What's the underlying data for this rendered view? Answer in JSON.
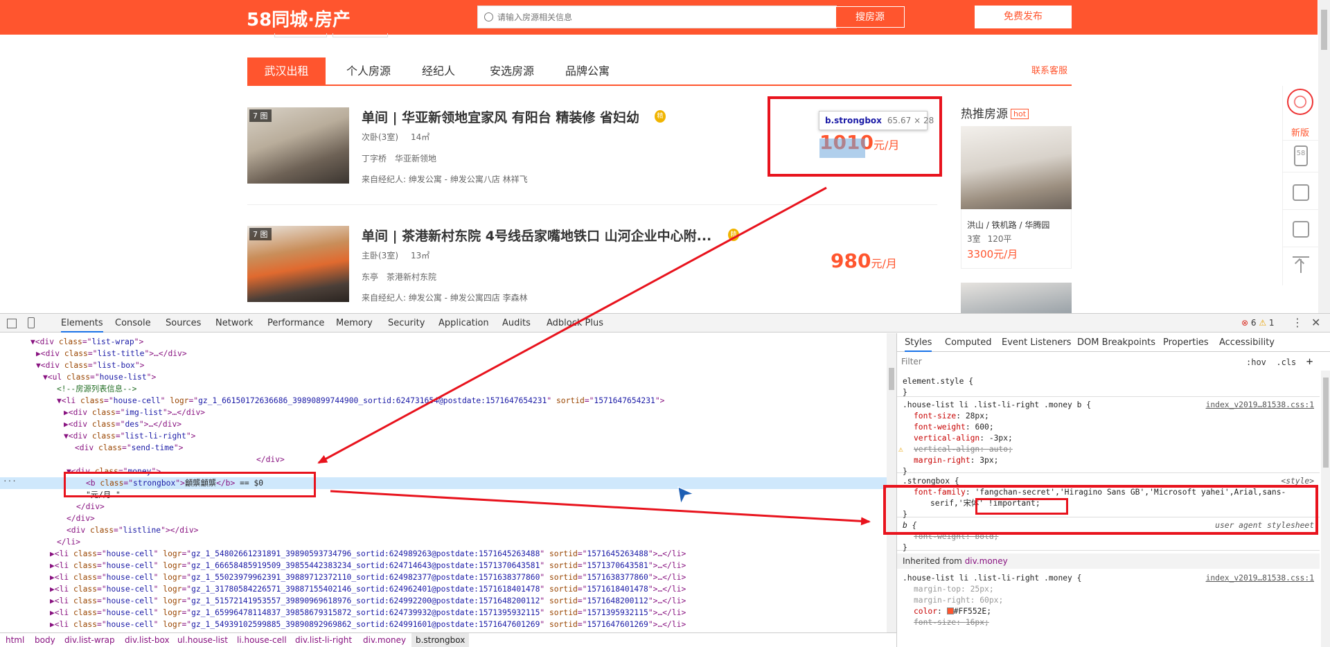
{
  "header": {
    "logo": "58同城·房产",
    "search_placeholder": "请输入房源相关信息",
    "search_button": "搜房源",
    "publish_button": "免费发布"
  },
  "tabs": {
    "items": [
      "武汉出租",
      "个人房源",
      "经纪人",
      "安选房源",
      "品牌公寓"
    ],
    "contact": "联系客服"
  },
  "listings": [
    {
      "photo_count": "7 图",
      "title": "单间 | 华亚新领地宜家风 有阳台 精装修 省妇幼",
      "medal": "精",
      "room": "次卧(3室)",
      "area": "14㎡",
      "district": "丁字桥",
      "community": "华亚新领地",
      "agent": "来自经纪人: 绅发公寓 - 绅发公寓八店 林祥飞",
      "price": "1010",
      "unit": "元/月"
    },
    {
      "photo_count": "7 图",
      "title": "单间 | 茶港新村东院 4号线岳家嘴地铁口 山河企业中心附...",
      "medal": "精",
      "room": "主卧(3室)",
      "area": "13㎡",
      "district": "东亭",
      "community": "茶港新村东院",
      "agent": "来自经纪人: 绅发公寓 - 绅发公寓四店 李森林",
      "price": "980",
      "unit": "元/月"
    }
  ],
  "tooltip": {
    "selector": "b.strongbox",
    "size": "65.67 × 28"
  },
  "hot": {
    "title": "热推房源",
    "tag": "hot",
    "location": "洪山 / 铁机路 / 华腾园",
    "rooms": "3室",
    "area": "120平",
    "price": "3300元/月"
  },
  "rail": {
    "new_label": "新版",
    "logo_text": "58"
  },
  "devtools": {
    "tabs": [
      "Elements",
      "Console",
      "Sources",
      "Network",
      "Performance",
      "Memory",
      "Security",
      "Application",
      "Audits",
      "Adblock Plus"
    ],
    "errors": "6",
    "warnings": "1",
    "tree": [
      {
        "parts": [
          [
            "t",
            "▼<div "
          ],
          [
            "an",
            "class"
          ],
          [
            "t",
            "=\""
          ],
          [
            "av",
            "list-wrap"
          ],
          [
            "t",
            "\">"
          ]
        ]
      },
      {
        "parts": [
          [
            "t",
            "▶<div "
          ],
          [
            "an",
            "class"
          ],
          [
            "t",
            "=\""
          ],
          [
            "av",
            "list-title"
          ],
          [
            "t",
            "\">…</div>"
          ]
        ]
      },
      {
        "parts": [
          [
            "t",
            "▼<div "
          ],
          [
            "an",
            "class"
          ],
          [
            "t",
            "=\""
          ],
          [
            "av",
            "list-box"
          ],
          [
            "t",
            "\">"
          ]
        ]
      },
      {
        "parts": [
          [
            "t",
            "▼<ul "
          ],
          [
            "an",
            "class"
          ],
          [
            "t",
            "=\""
          ],
          [
            "av",
            "house-list"
          ],
          [
            "t",
            "\">"
          ]
        ]
      },
      {
        "parts": [
          [
            "cm",
            "<!--房源列表信息-->"
          ]
        ]
      },
      {
        "parts": [
          [
            "t",
            "▼<li "
          ],
          [
            "an",
            "class"
          ],
          [
            "t",
            "=\""
          ],
          [
            "av",
            "house-cell"
          ],
          [
            "t",
            "\" "
          ],
          [
            "an",
            "logr"
          ],
          [
            "t",
            "=\""
          ],
          [
            "av",
            "gz_1_66150172636686_39890899744900_sortid:624731654@postdate:1571647654231"
          ],
          [
            "t",
            "\" "
          ],
          [
            "an",
            "sortid"
          ],
          [
            "t",
            "=\""
          ],
          [
            "av",
            "1571647654231"
          ],
          [
            "t",
            "\">"
          ]
        ]
      },
      {
        "parts": [
          [
            "t",
            "▶<div "
          ],
          [
            "an",
            "class"
          ],
          [
            "t",
            "=\""
          ],
          [
            "av",
            "img-list"
          ],
          [
            "t",
            "\">…</div>"
          ]
        ]
      },
      {
        "parts": [
          [
            "t",
            "▶<div "
          ],
          [
            "an",
            "class"
          ],
          [
            "t",
            "=\""
          ],
          [
            "av",
            "des"
          ],
          [
            "t",
            "\">…</div>"
          ]
        ]
      },
      {
        "parts": [
          [
            "t",
            "▼<div "
          ],
          [
            "an",
            "class"
          ],
          [
            "t",
            "=\""
          ],
          [
            "av",
            "list-li-right"
          ],
          [
            "t",
            "\">"
          ]
        ]
      },
      {
        "parts": [
          [
            "t",
            "<div "
          ],
          [
            "an",
            "class"
          ],
          [
            "t",
            "=\""
          ],
          [
            "av",
            "send-time"
          ],
          [
            "t",
            "\">"
          ]
        ]
      },
      {
        "parts": [
          [
            "t",
            "</div>"
          ]
        ]
      },
      {
        "parts": [
          [
            "t",
            "▼<div "
          ],
          [
            "an",
            "class"
          ],
          [
            "t",
            "=\""
          ],
          [
            "av",
            "money"
          ],
          [
            "t",
            "\">"
          ]
        ]
      },
      {
        "parts": [
          [
            "t",
            "<b "
          ],
          [
            "an",
            "class"
          ],
          [
            "t",
            "=\""
          ],
          [
            "av",
            "strongbox"
          ],
          [
            "t",
            "\">"
          ],
          [
            "tx",
            "龥龒龥龒"
          ],
          [
            "t",
            "</b>"
          ],
          [
            "tx",
            " == $0"
          ]
        ]
      },
      {
        "parts": [
          [
            "tx",
            "\"元/月"
          ],
          [
            "tx",
            "                              \""
          ]
        ]
      },
      {
        "parts": [
          [
            "t",
            "</div>"
          ]
        ]
      },
      {
        "parts": [
          [
            "t",
            "</div>"
          ]
        ]
      },
      {
        "parts": [
          [
            "t",
            "<div "
          ],
          [
            "an",
            "class"
          ],
          [
            "t",
            "=\""
          ],
          [
            "av",
            "listline"
          ],
          [
            "t",
            "\"></div>"
          ]
        ]
      },
      {
        "parts": [
          [
            "t",
            "</li>"
          ]
        ]
      },
      {
        "parts": [
          [
            "t",
            "▶<li "
          ],
          [
            "an",
            "class"
          ],
          [
            "t",
            "=\""
          ],
          [
            "av",
            "house-cell"
          ],
          [
            "t",
            "\" "
          ],
          [
            "an",
            "logr"
          ],
          [
            "t",
            "=\""
          ],
          [
            "av",
            "gz_1_54802661231891_39890593734796_sortid:624989263@postdate:1571645263488"
          ],
          [
            "t",
            "\" "
          ],
          [
            "an",
            "sortid"
          ],
          [
            "t",
            "=\""
          ],
          [
            "av",
            "1571645263488"
          ],
          [
            "t",
            "\">…</li>"
          ]
        ]
      },
      {
        "parts": [
          [
            "t",
            "▶<li "
          ],
          [
            "an",
            "class"
          ],
          [
            "t",
            "=\""
          ],
          [
            "av",
            "house-cell"
          ],
          [
            "t",
            "\" "
          ],
          [
            "an",
            "logr"
          ],
          [
            "t",
            "=\""
          ],
          [
            "av",
            "gz_1_66658485919509_39855442383234_sortid:624714643@postdate:1571370643581"
          ],
          [
            "t",
            "\" "
          ],
          [
            "an",
            "sortid"
          ],
          [
            "t",
            "=\""
          ],
          [
            "av",
            "1571370643581"
          ],
          [
            "t",
            "\">…</li>"
          ]
        ]
      },
      {
        "parts": [
          [
            "t",
            "▶<li "
          ],
          [
            "an",
            "class"
          ],
          [
            "t",
            "=\""
          ],
          [
            "av",
            "house-cell"
          ],
          [
            "t",
            "\" "
          ],
          [
            "an",
            "logr"
          ],
          [
            "t",
            "=\""
          ],
          [
            "av",
            "gz_1_55023979962391_39889712372110_sortid:624982377@postdate:1571638377860"
          ],
          [
            "t",
            "\" "
          ],
          [
            "an",
            "sortid"
          ],
          [
            "t",
            "=\""
          ],
          [
            "av",
            "1571638377860"
          ],
          [
            "t",
            "\">…</li>"
          ]
        ]
      },
      {
        "parts": [
          [
            "t",
            "▶<li "
          ],
          [
            "an",
            "class"
          ],
          [
            "t",
            "=\""
          ],
          [
            "av",
            "house-cell"
          ],
          [
            "t",
            "\" "
          ],
          [
            "an",
            "logr"
          ],
          [
            "t",
            "=\""
          ],
          [
            "av",
            "gz_1_31780584226571_39887155402146_sortid:624962401@postdate:1571618401478"
          ],
          [
            "t",
            "\" "
          ],
          [
            "an",
            "sortid"
          ],
          [
            "t",
            "=\""
          ],
          [
            "av",
            "1571618401478"
          ],
          [
            "t",
            "\">…</li>"
          ]
        ]
      },
      {
        "parts": [
          [
            "t",
            "▶<li "
          ],
          [
            "an",
            "class"
          ],
          [
            "t",
            "=\""
          ],
          [
            "av",
            "house-cell"
          ],
          [
            "t",
            "\" "
          ],
          [
            "an",
            "logr"
          ],
          [
            "t",
            "=\""
          ],
          [
            "av",
            "gz_1_51572141953557_39890969618976_sortid:624992200@postdate:1571648200112"
          ],
          [
            "t",
            "\" "
          ],
          [
            "an",
            "sortid"
          ],
          [
            "t",
            "=\""
          ],
          [
            "av",
            "1571648200112"
          ],
          [
            "t",
            "\">…</li>"
          ]
        ]
      },
      {
        "parts": [
          [
            "t",
            "▶<li "
          ],
          [
            "an",
            "class"
          ],
          [
            "t",
            "=\""
          ],
          [
            "av",
            "house-cell"
          ],
          [
            "t",
            "\" "
          ],
          [
            "an",
            "logr"
          ],
          [
            "t",
            "=\""
          ],
          [
            "av",
            "gz_1_65996478114837_39858679315872_sortid:624739932@postdate:1571395932115"
          ],
          [
            "t",
            "\" "
          ],
          [
            "an",
            "sortid"
          ],
          [
            "t",
            "=\""
          ],
          [
            "av",
            "1571395932115"
          ],
          [
            "t",
            "\">…</li>"
          ]
        ]
      },
      {
        "parts": [
          [
            "t",
            "▶<li "
          ],
          [
            "an",
            "class"
          ],
          [
            "t",
            "=\""
          ],
          [
            "av",
            "house-cell"
          ],
          [
            "t",
            "\" "
          ],
          [
            "an",
            "logr"
          ],
          [
            "t",
            "=\""
          ],
          [
            "av",
            "gz_1_54939102599885_39890892969862_sortid:624991601@postdate:1571647601269"
          ],
          [
            "t",
            "\" "
          ],
          [
            "an",
            "sortid"
          ],
          [
            "t",
            "=\""
          ],
          [
            "av",
            "1571647601269"
          ],
          [
            "t",
            "\">…</li>"
          ]
        ]
      }
    ],
    "breadcrumbs": [
      "html",
      "body",
      "div.list-wrap",
      "div.list-box",
      "ul.house-list",
      "li.house-cell",
      "div.list-li-right",
      "div.money",
      "b.strongbox"
    ],
    "styles": {
      "tabs": [
        "Styles",
        "Computed",
        "Event Listeners",
        "DOM Breakpoints",
        "Properties",
        "Accessibility"
      ],
      "filter_placeholder": "Filter",
      "hov": ":hov",
      "cls": ".cls",
      "plus": "+",
      "element_style": "element.style {",
      "close": "}",
      "rule1_selector": ".house-list li .list-li-right .money b {",
      "rule1_source": "index_v2019…81538.css:1",
      "rule1_props": [
        [
          "font-size",
          "28px;"
        ],
        [
          "font-weight",
          "600;"
        ],
        [
          "vertical-align",
          "-3px;"
        ],
        [
          "vertical-align",
          "auto;"
        ],
        [
          "margin-right",
          "3px;"
        ]
      ],
      "rule2_selector": ".strongbox {",
      "rule2_source": "<style>",
      "rule2_prop": "font-family",
      "rule2_value_secret": "'fangchan-secret'",
      "rule2_value_rest": ",'Hiragino Sans GB','Microsoft yahei',Arial,sans-",
      "rule2_value_rest2": "serif,'宋体' !important;",
      "rule3_selector": "b {",
      "rule3_source": "user agent stylesheet",
      "rule3_prop": "font-weight: bold;",
      "inherited_label": "Inherited from",
      "inherited_from": "div.money",
      "rule4_selector": ".house-list li .list-li-right .money {",
      "rule4_source": "index_v2019…81538.css:1",
      "rule4_props": [
        [
          "margin-top",
          "25px;"
        ],
        [
          "margin-right",
          "60px;"
        ],
        [
          "color",
          "#FF552E;"
        ],
        [
          "font-size",
          "16px;"
        ]
      ]
    }
  }
}
